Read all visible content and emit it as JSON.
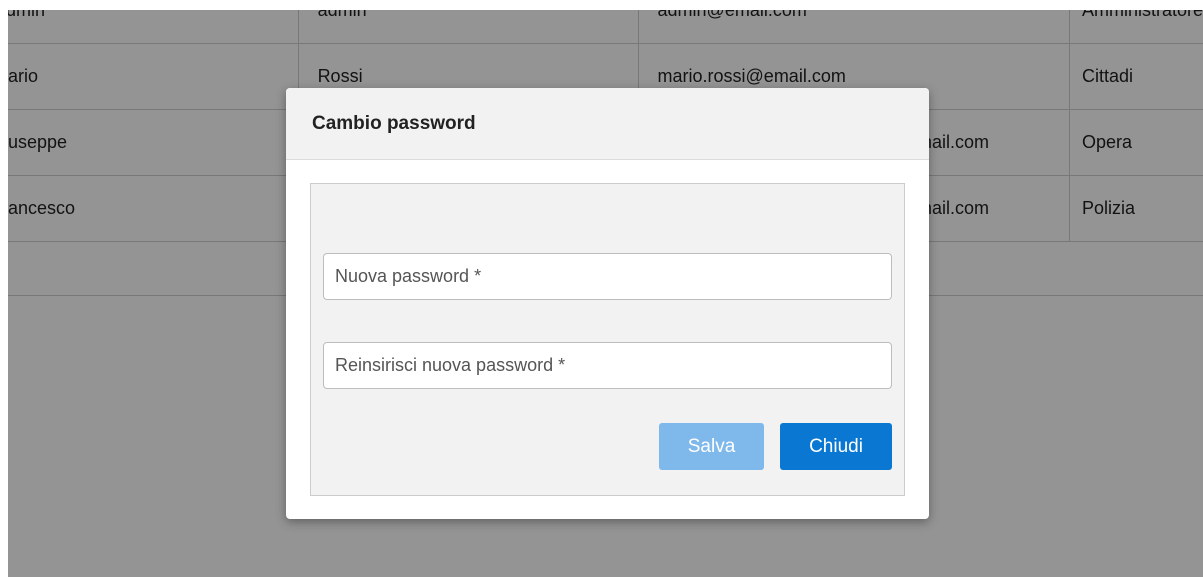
{
  "table": {
    "rows": [
      {
        "nome": "Admin",
        "cognome": "admin",
        "email": "admin@email.com",
        "ruolo": "Amministratore"
      },
      {
        "nome": "ario",
        "cognome": "Rossi",
        "email": "mario.rossi@email.com",
        "ruolo": "Cittadi"
      },
      {
        "nome": "useppe",
        "cognome": "",
        "email": "email.com",
        "ruolo": "Opera"
      },
      {
        "nome": "ancesco",
        "cognome": "",
        "email": "@email.com",
        "ruolo": "Polizia"
      }
    ]
  },
  "modal": {
    "title": "Cambio password",
    "new_password_placeholder": "Nuova password *",
    "confirm_password_placeholder": "Reinsirisci nuova password *",
    "save_label": "Salva",
    "close_label": "Chiudi"
  }
}
